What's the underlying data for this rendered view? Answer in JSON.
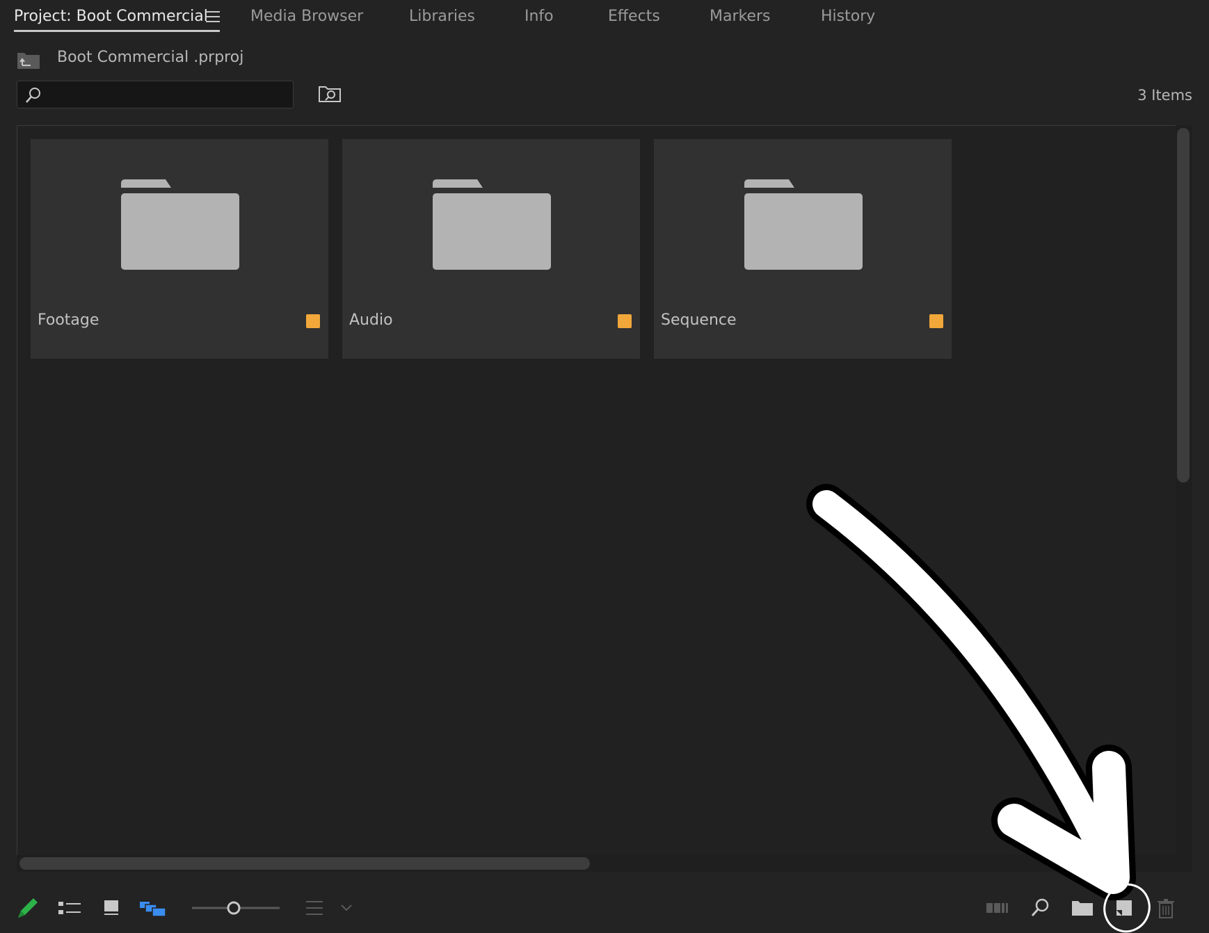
{
  "tabs": [
    {
      "label": "Project: Boot Commercial",
      "active": true
    },
    {
      "label": "Media Browser"
    },
    {
      "label": "Libraries"
    },
    {
      "label": "Info"
    },
    {
      "label": "Effects"
    },
    {
      "label": "Markers"
    },
    {
      "label": "History"
    }
  ],
  "project": {
    "path": "Boot Commercial .prproj"
  },
  "search": {
    "value": "",
    "placeholder": ""
  },
  "item_count": "3 Items",
  "bins": [
    {
      "name": "Footage",
      "label_color": "#f1a73a"
    },
    {
      "name": "Audio",
      "label_color": "#f1a73a"
    },
    {
      "name": "Sequence",
      "label_color": "#f1a73a"
    }
  ],
  "toolbar": {
    "icons": [
      "pencil-icon",
      "list-view-icon",
      "icon-view-icon",
      "freeform-view-icon",
      "zoom-slider",
      "sort-icon",
      "automate-to-sequence-icon",
      "find-icon",
      "new-bin-icon",
      "new-item-icon",
      "trash-icon"
    ]
  },
  "colors": {
    "background": "#232323",
    "card": "#313131",
    "folder": "#b3b3b3",
    "label_orange": "#f1a73a",
    "pencil_green": "#2db24a",
    "freeform_blue": "#3a8df0"
  }
}
